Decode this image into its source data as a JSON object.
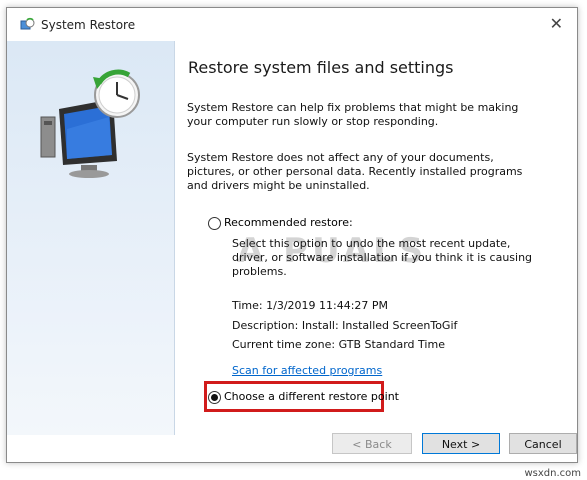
{
  "window": {
    "title": "System Restore",
    "close_glyph": "✕"
  },
  "main": {
    "heading": "Restore system files and settings",
    "paragraph1": "System Restore can help fix problems that might be making your computer run slowly or stop responding.",
    "paragraph2": "System Restore does not affect any of your documents, pictures, or other personal data. Recently installed programs and drivers might be uninstalled.",
    "recommended_label": "Recommended restore:",
    "recommended_description": "Select this option to undo the most recent update, driver, or software installation if you think it is causing problems.",
    "time": "Time: 1/3/2019 11:44:27 PM",
    "description": "Description: Install: Installed ScreenToGif",
    "timezone": "Current time zone: GTB Standard Time",
    "scan_link": "Scan for affected programs",
    "different_label": "Choose a different restore point",
    "selected_option": "different"
  },
  "buttons": {
    "back": "< Back",
    "next": "Next >",
    "cancel": "Cancel"
  },
  "watermark": "A  PUALS",
  "credit": "wsxdn.com",
  "colors": {
    "highlight": "#d11b1b",
    "link": "#0066cc",
    "sidebar": "#dbe8f5"
  },
  "icons": [
    "system-restore-icon",
    "close-icon",
    "restore-clock-monitor-icon"
  ]
}
